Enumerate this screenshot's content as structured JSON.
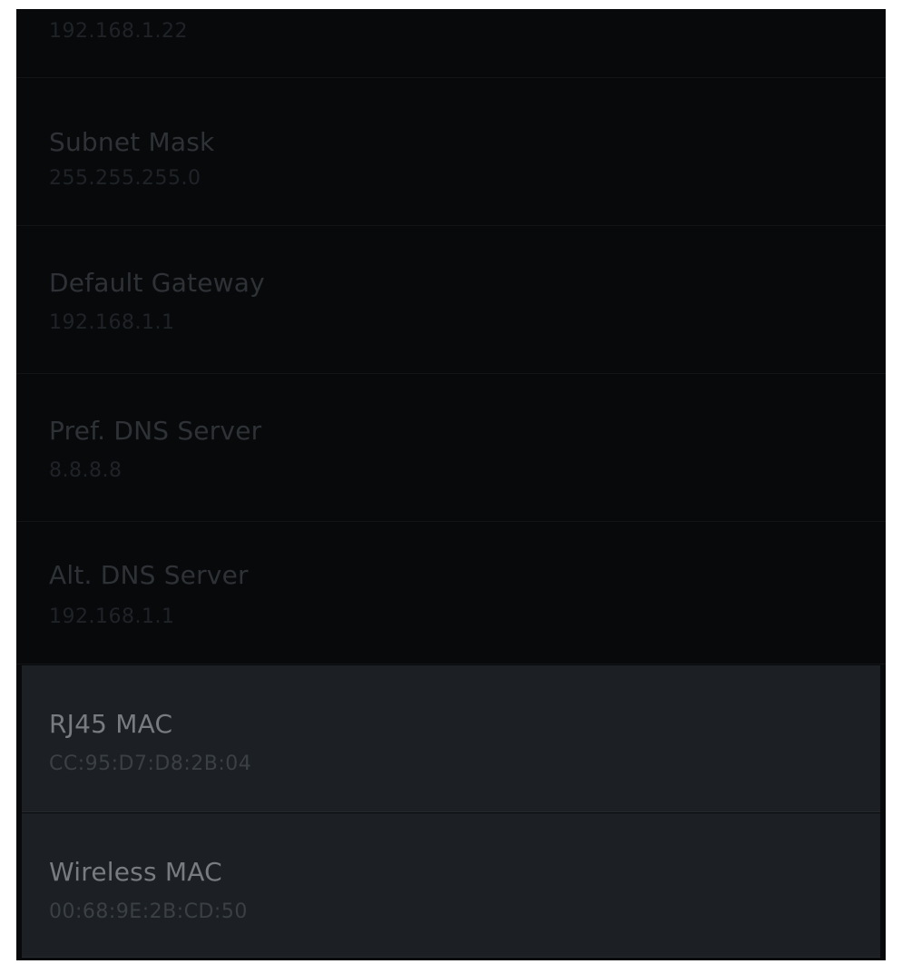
{
  "network_info": {
    "ip_address": {
      "value": "192.168.1.22"
    },
    "items": [
      {
        "label": "Subnet Mask",
        "value": "255.255.255.0"
      },
      {
        "label": "Default Gateway",
        "value": "192.168.1.1"
      },
      {
        "label": "Pref. DNS Server",
        "value": "8.8.8.8"
      },
      {
        "label": "Alt. DNS Server",
        "value": "192.168.1.1"
      },
      {
        "label": "RJ45 MAC",
        "value": "CC:95:D7:D8:2B:04"
      },
      {
        "label": "Wireless MAC",
        "value": "00:68:9E:2B:CD:50"
      }
    ]
  }
}
